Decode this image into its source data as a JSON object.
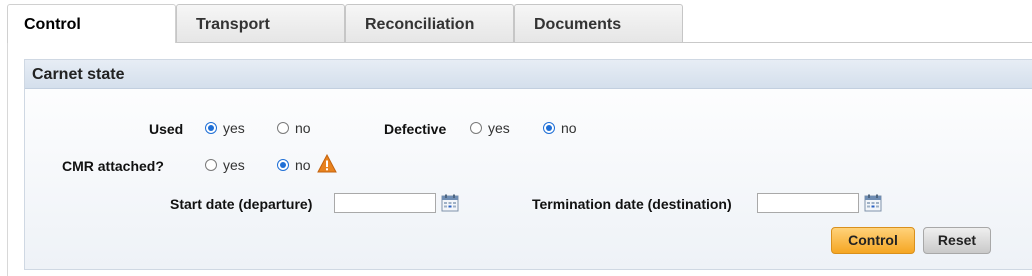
{
  "tabs": [
    {
      "label": "Control",
      "active": true
    },
    {
      "label": "Transport",
      "active": false
    },
    {
      "label": "Reconciliation",
      "active": false
    },
    {
      "label": "Documents",
      "active": false
    }
  ],
  "section": {
    "title": "Carnet state"
  },
  "fields": {
    "used": {
      "label": "Used",
      "options": [
        "yes",
        "no"
      ],
      "selected": "yes"
    },
    "defective": {
      "label": "Defective",
      "options": [
        "yes",
        "no"
      ],
      "selected": "no"
    },
    "cmr": {
      "label": "CMR attached?",
      "options": [
        "yes",
        "no"
      ],
      "selected": "no",
      "warning_icon": "warning-triangle-icon"
    },
    "start_date": {
      "label": "Start date (departure)",
      "value": "",
      "icon": "calendar-icon"
    },
    "termination_date": {
      "label": "Termination date (destination)",
      "value": "",
      "icon": "calendar-icon"
    }
  },
  "buttons": {
    "control": "Control",
    "reset": "Reset"
  },
  "colors": {
    "primary_button": "#f5a623",
    "radio_selected": "#1f6fd6",
    "warning": "#e8821e"
  }
}
